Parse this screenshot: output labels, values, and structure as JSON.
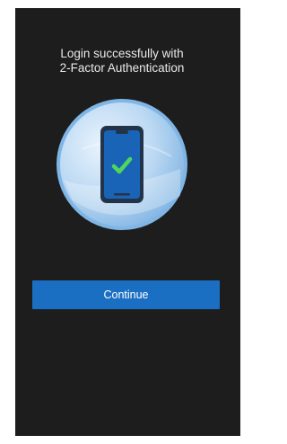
{
  "screen": {
    "title_line_1": "Login successfully with",
    "title_line_2": "2-Factor Authentication",
    "illustration_icon": "phone-check-icon",
    "continue_label": "Continue"
  },
  "colors": {
    "background": "#1d1d1d",
    "accent": "#1b6fc2",
    "check": "#4fd65c"
  }
}
